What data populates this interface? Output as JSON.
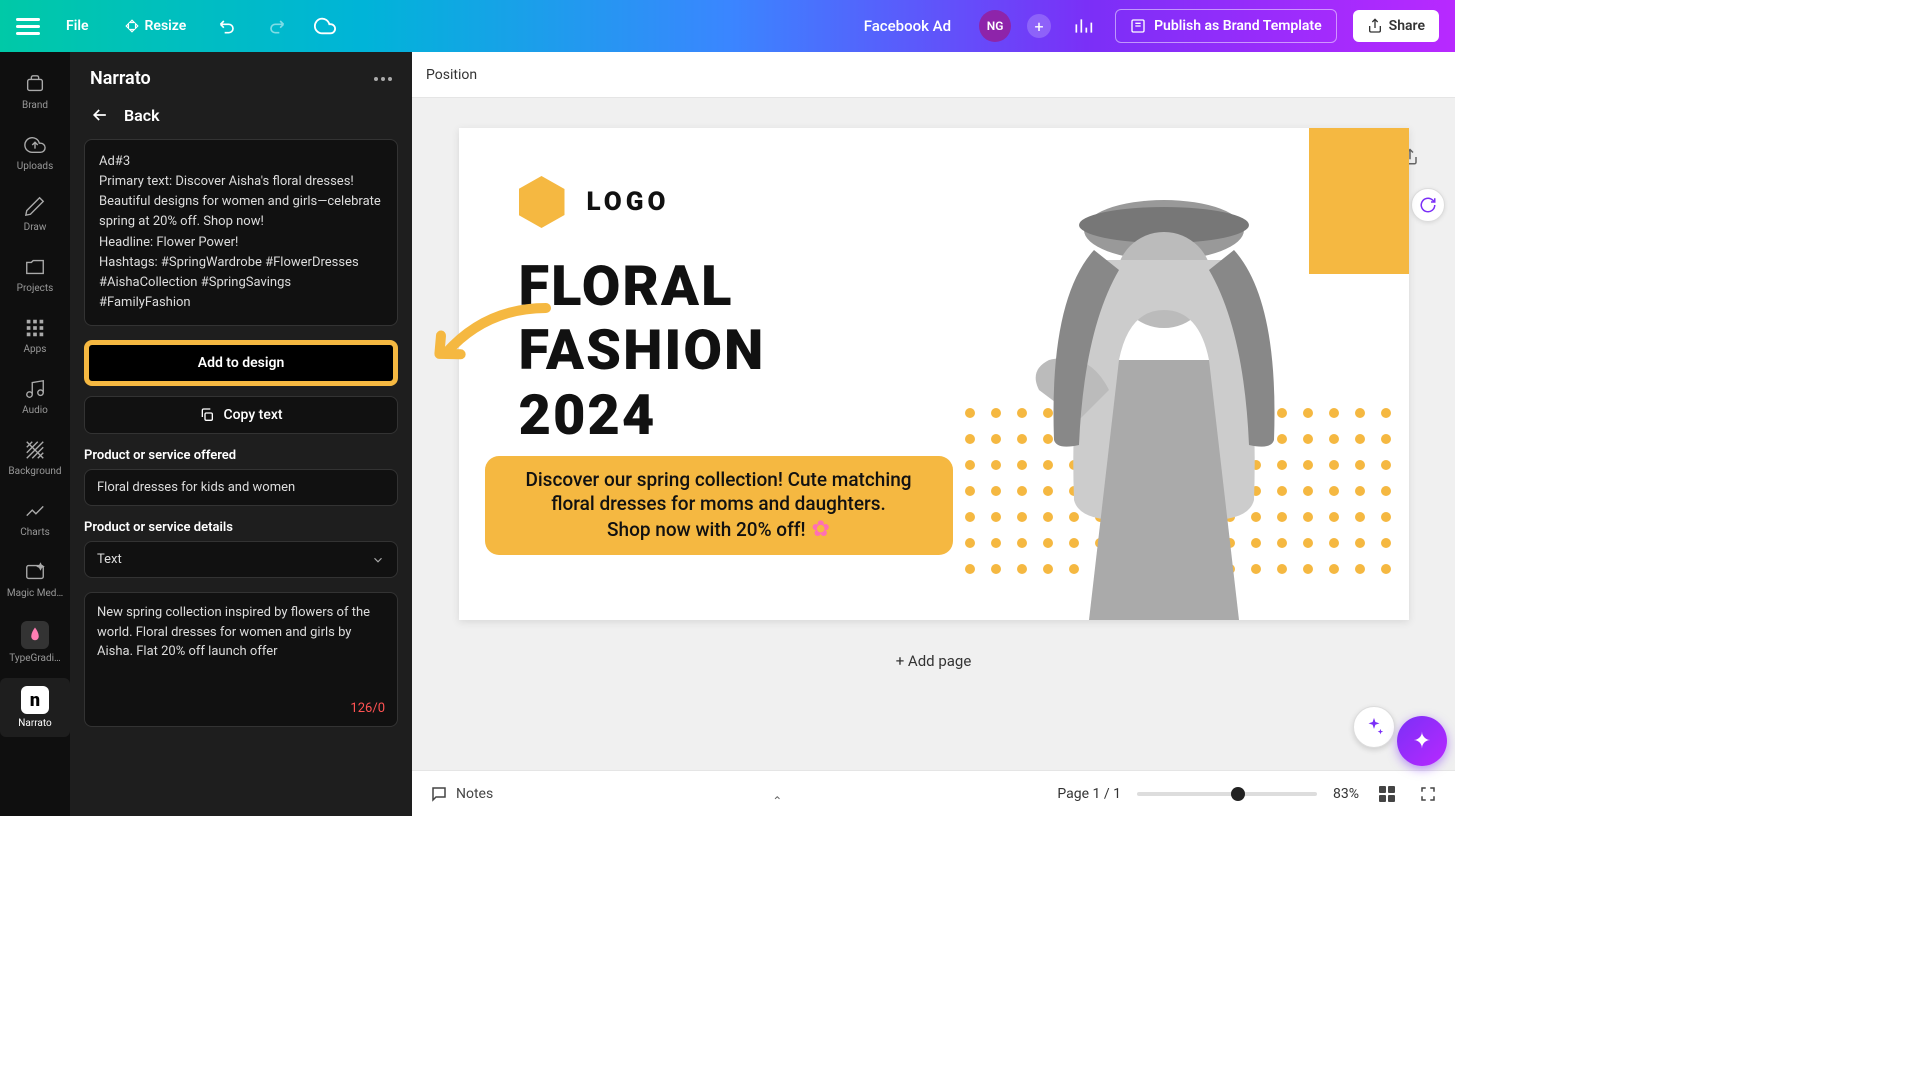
{
  "topbar": {
    "file": "File",
    "resize": "Resize",
    "docTitle": "Facebook Ad",
    "avatar": "NG",
    "publish": "Publish as Brand Template",
    "share": "Share"
  },
  "rail": {
    "brand": "Brand",
    "uploads": "Uploads",
    "draw": "Draw",
    "projects": "Projects",
    "apps": "Apps",
    "audio": "Audio",
    "background": "Background",
    "charts": "Charts",
    "magic": "Magic Med…",
    "typegrad": "TypeGradi…",
    "narrato": "Narrato"
  },
  "panel": {
    "title": "Narrato",
    "back": "Back",
    "adTitle": "Ad#3",
    "adPrimary": "Primary text: Discover Aisha's floral dresses! Beautiful designs for women and girls—celebrate spring at 20% off. Shop now!",
    "adHeadline": "Headline: Flower Power!",
    "adHashtags": "Hashtags: #SpringWardrobe #FlowerDresses #AishaCollection #SpringSavings #FamilyFashion",
    "addToDesign": "Add to design",
    "copyText": "Copy text",
    "productLabel": "Product or service offered",
    "productValue": "Floral dresses for kids and women",
    "detailsLabel": "Product or service details",
    "detailsType": "Text",
    "detailsValue": "New spring collection inspired by flowers of the world. Floral dresses for women and girls by Aisha. Flat 20% off launch offer",
    "counter": "126/0"
  },
  "canvas": {
    "position": "Position",
    "logo": "LOGO",
    "headline1": "FLORAL",
    "headline2": "FASHION",
    "headline3": "2024",
    "subhead1": "Discover our spring collection! Cute matching floral dresses for moms and daughters.",
    "subhead2": "Shop now with 20% off!",
    "addPage": "+ Add page"
  },
  "footer": {
    "notes": "Notes",
    "pageIndicator": "Page 1 / 1",
    "zoom": "83%"
  }
}
